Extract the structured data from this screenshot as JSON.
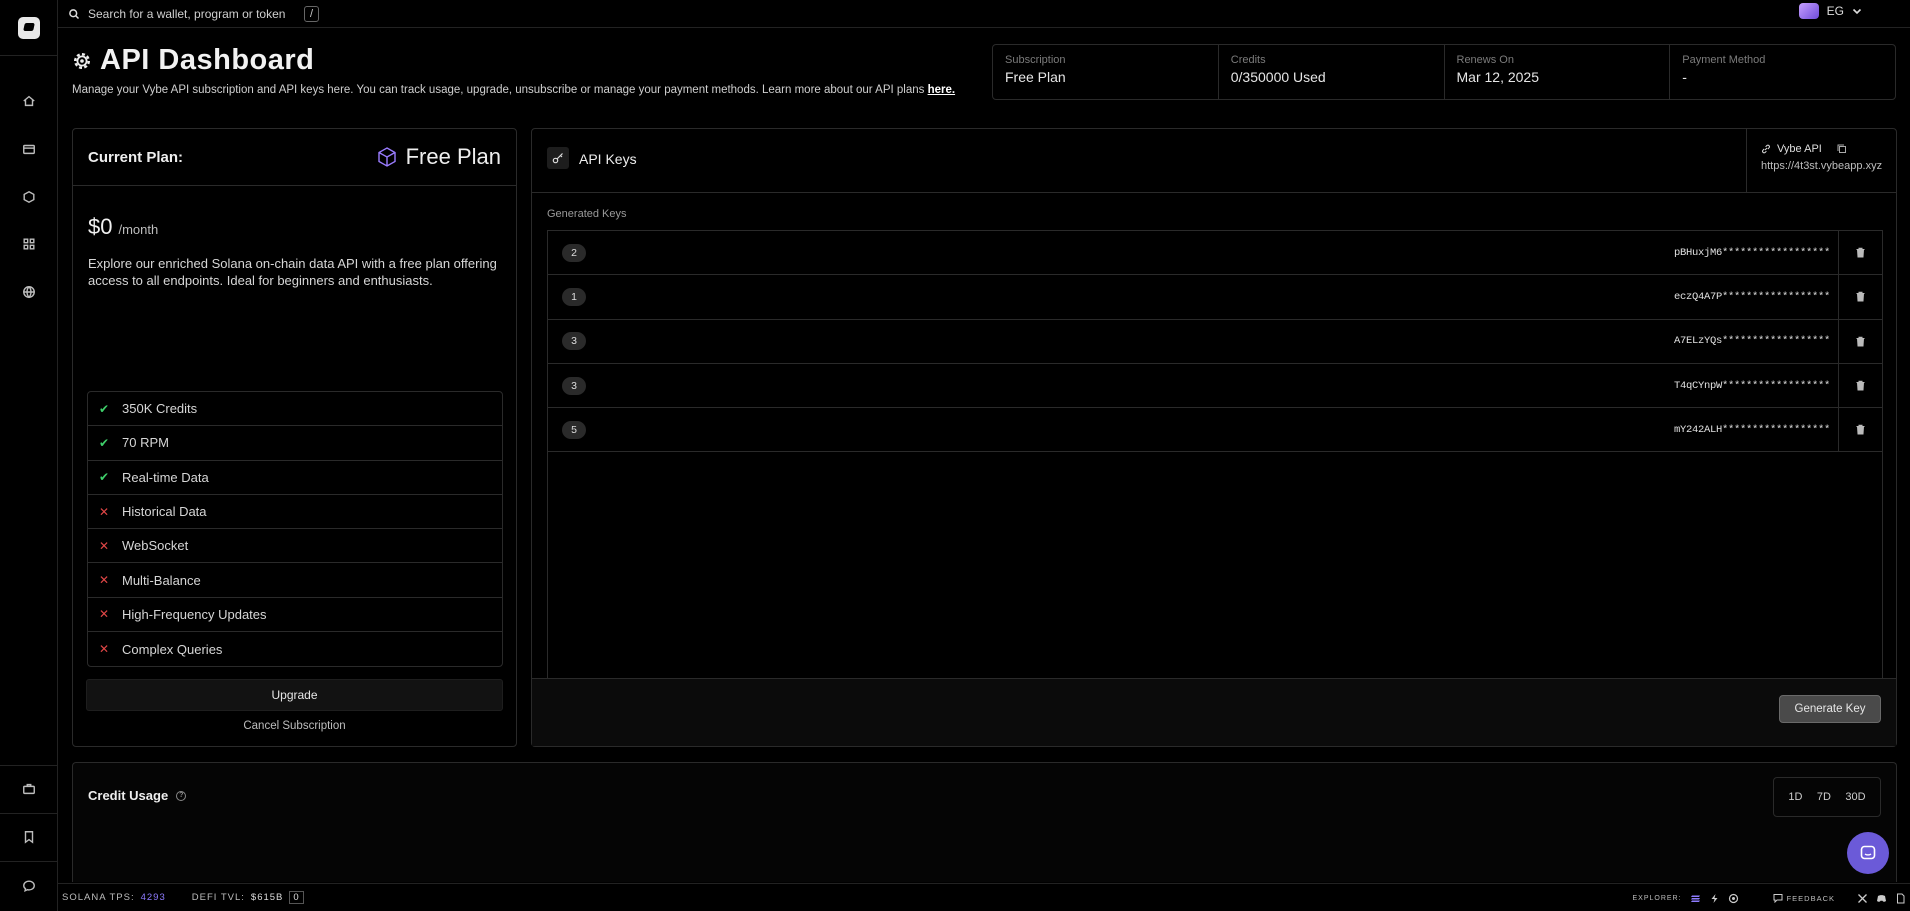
{
  "search": {
    "placeholder": "Search for a wallet, program or token",
    "shortcut": "/"
  },
  "user": {
    "initials": "EG"
  },
  "header": {
    "title": "API Dashboard",
    "description": "Manage your Vybe API subscription and API keys here. You can track usage, upgrade, unsubscribe or manage your payment methods. Learn more about our API plans",
    "link_text": "here."
  },
  "summary": [
    {
      "label": "Subscription",
      "value": "Free Plan"
    },
    {
      "label": "Credits",
      "value": "0/350000 Used"
    },
    {
      "label": "Renews On",
      "value": "Mar 12, 2025"
    },
    {
      "label": "Payment Method",
      "value": "-"
    }
  ],
  "plan": {
    "heading": "Current Plan:",
    "name": "Free Plan",
    "price": "$0",
    "period": "/month",
    "description": "Explore our enriched Solana on-chain data API with a free plan offering access to all endpoints. Ideal for beginners and enthusiasts.",
    "features": [
      {
        "label": "350K Credits",
        "included": true
      },
      {
        "label": "70 RPM",
        "included": true
      },
      {
        "label": "Real-time Data",
        "included": true
      },
      {
        "label": "Historical Data",
        "included": false
      },
      {
        "label": "WebSocket",
        "included": false
      },
      {
        "label": "Multi-Balance",
        "included": false
      },
      {
        "label": "High-Frequency Updates",
        "included": false
      },
      {
        "label": "Complex Queries",
        "included": false
      }
    ],
    "upgrade_label": "Upgrade",
    "cancel_label": "Cancel Subscription"
  },
  "keys": {
    "title": "API Keys",
    "endpoint_name": "Vybe API",
    "endpoint_url": "https://4t3st.vybeapp.xyz",
    "generated_label": "Generated Keys",
    "items": [
      {
        "num": "2",
        "key": "pBHuxjM6******************"
      },
      {
        "num": "1",
        "key": "eczQ4A7P******************"
      },
      {
        "num": "3",
        "key": "A7ELzYQs******************"
      },
      {
        "num": "3",
        "key": "T4qCYnpW******************"
      },
      {
        "num": "5",
        "key": "mY242ALH******************"
      }
    ],
    "generate_label": "Generate Key"
  },
  "usage": {
    "title": "Credit Usage",
    "ranges": [
      "1D",
      "7D",
      "30D"
    ]
  },
  "statusbar": {
    "tps_label": "SOLANA TPS:",
    "tps_value": "4293",
    "defi_label": "DEFI TVL:",
    "defi_value": "$615B",
    "defi_box": "0",
    "explorer_label": "EXPLORER:",
    "feedback_label": "FEEDBACK"
  }
}
